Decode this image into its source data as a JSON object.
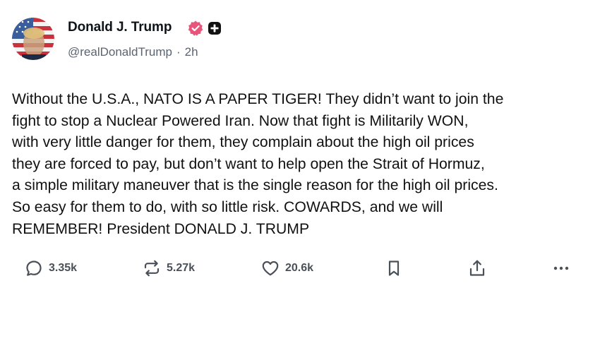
{
  "author": {
    "name": "Donald J. Trump",
    "handle": "@realDonaldTrump",
    "separator": "·",
    "time": "2h",
    "verified_color": "#e8557a"
  },
  "post": {
    "text": "Without the U.S.A., NATO IS A PAPER TIGER! They didn’t want to join the\nfight to stop a Nuclear Powered Iran. Now that fight is Militarily WON,\nwith very little danger for them, they complain about the high oil prices\nthey are forced to pay, but don’t want to help open the Strait of Hormuz,\na simple military maneuver that is the single reason for the high oil prices.\nSo easy for them to do, with so little risk. COWARDS, and we will\nREMEMBER! President DONALD J. TRUMP"
  },
  "actions": {
    "reply": {
      "icon": "reply-icon",
      "count": "3.35k"
    },
    "repost": {
      "icon": "repost-icon",
      "count": "5.27k"
    },
    "like": {
      "icon": "heart-icon",
      "count": "20.6k"
    },
    "bookmark": {
      "icon": "bookmark-icon"
    },
    "share": {
      "icon": "share-icon"
    },
    "more": {
      "icon": "more-icon"
    }
  }
}
